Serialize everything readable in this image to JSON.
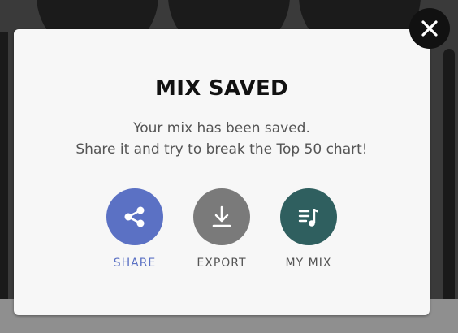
{
  "dialog": {
    "title": "MIX SAVED",
    "message_line1": "Your mix has been saved.",
    "message_line2": "Share it and try to break the Top 50 chart!"
  },
  "actions": [
    {
      "label": "SHARE",
      "icon": "share-icon",
      "color": "#5b71c4"
    },
    {
      "label": "EXPORT",
      "icon": "download-icon",
      "color": "#7a7a7a"
    },
    {
      "label": "MY MIX",
      "icon": "playlist-icon",
      "color": "#2f5f5f"
    }
  ],
  "close": {
    "icon": "close-icon",
    "color": "#111111"
  }
}
